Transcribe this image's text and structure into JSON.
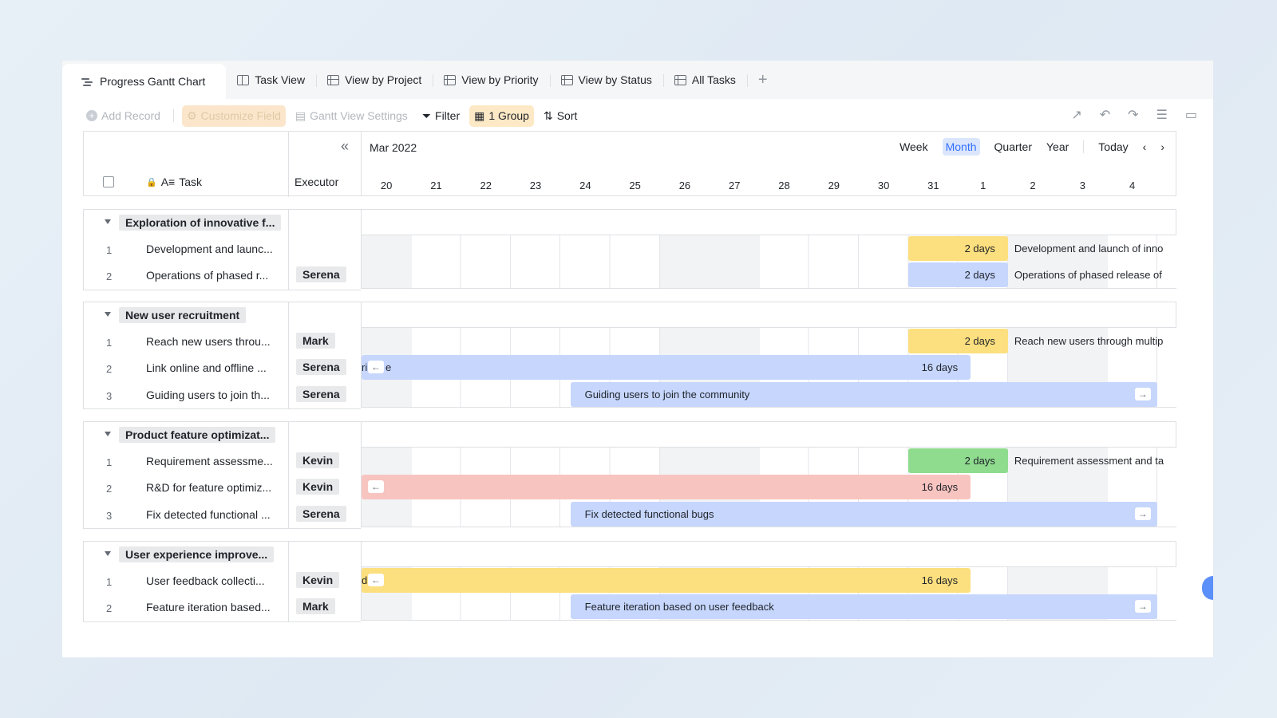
{
  "tabs": [
    {
      "label": "Progress Gantt Chart",
      "icon": "gantt-icon",
      "active": true
    },
    {
      "label": "Task View",
      "icon": "kanban-icon"
    },
    {
      "label": "View by Project",
      "icon": "grid-icon"
    },
    {
      "label": "View by Priority",
      "icon": "grid-icon"
    },
    {
      "label": "View by Status",
      "icon": "grid-icon"
    },
    {
      "label": "All Tasks",
      "icon": "grid-icon"
    }
  ],
  "add_tab": "+",
  "toolbar": {
    "add_record": "Add Record",
    "customize_field": "Customize Field",
    "gantt_settings": "Gantt View Settings",
    "filter": "Filter",
    "group": "1 Group",
    "sort": "Sort"
  },
  "columns": {
    "task": "Task",
    "executor": "Executor"
  },
  "timeline": {
    "month": "Mar 2022",
    "scales": [
      "Week",
      "Month",
      "Quarter",
      "Year"
    ],
    "selected_scale": "Month",
    "today": "Today",
    "days": [
      "20",
      "21",
      "22",
      "23",
      "24",
      "25",
      "26",
      "27",
      "28",
      "29",
      "30",
      "31",
      "1",
      "2",
      "3",
      "4"
    ]
  },
  "groups": [
    {
      "title": "Exploration of innovative f...",
      "rows": [
        {
          "num": "1",
          "task": "Development and launc...",
          "executor": ""
        },
        {
          "num": "2",
          "task": "Operations of phased r...",
          "executor": "Serena"
        }
      ]
    },
    {
      "title": "New user recruitment",
      "rows": [
        {
          "num": "1",
          "task": "Reach new users throu...",
          "executor": "Mark"
        },
        {
          "num": "2",
          "task": "Link online and offline ...",
          "executor": "Serena"
        },
        {
          "num": "3",
          "task": "Guiding users to join th...",
          "executor": "Serena"
        }
      ]
    },
    {
      "title": "Product feature optimizat...",
      "rows": [
        {
          "num": "1",
          "task": "Requirement assessme...",
          "executor": "Kevin"
        },
        {
          "num": "2",
          "task": "R&D for feature optimiz...",
          "executor": "Kevin"
        },
        {
          "num": "3",
          "task": "Fix detected functional ...",
          "executor": "Serena"
        }
      ]
    },
    {
      "title": "User experience improve...",
      "rows": [
        {
          "num": "1",
          "task": "User feedback collecti...",
          "executor": "Kevin"
        },
        {
          "num": "2",
          "task": "Feature iteration based...",
          "executor": "Mark"
        }
      ]
    }
  ],
  "bars": {
    "g0r0": {
      "duration": "2 days",
      "label": "Development and launch of inno",
      "color": "#fcdf7e"
    },
    "g0r1": {
      "duration": "2 days",
      "label": "Operations of phased release of",
      "color": "#c6d6fd"
    },
    "g1r0": {
      "duration": "2 days",
      "label": "Reach new users through multip",
      "color": "#fcdf7e"
    },
    "g1r1": {
      "duration": "16 days",
      "prefix": "ri",
      "suffix": "e",
      "color": "#c6d6fd"
    },
    "g1r2": {
      "title": "Guiding users to join the community",
      "color": "#c6d6fd"
    },
    "g2r0": {
      "duration": "2 days",
      "label": "Requirement assessment and ta",
      "color": "#8fdc8f"
    },
    "g2r1": {
      "duration": "16 days",
      "color": "#f8c4c0"
    },
    "g2r2": {
      "title": "Fix detected functional bugs",
      "color": "#c6d6fd"
    },
    "g3r0": {
      "duration": "16 days",
      "prefix": "di",
      "color": "#fcdf7e"
    },
    "g3r1": {
      "title": "Feature iteration based on user feedback",
      "color": "#c6d6fd"
    }
  }
}
